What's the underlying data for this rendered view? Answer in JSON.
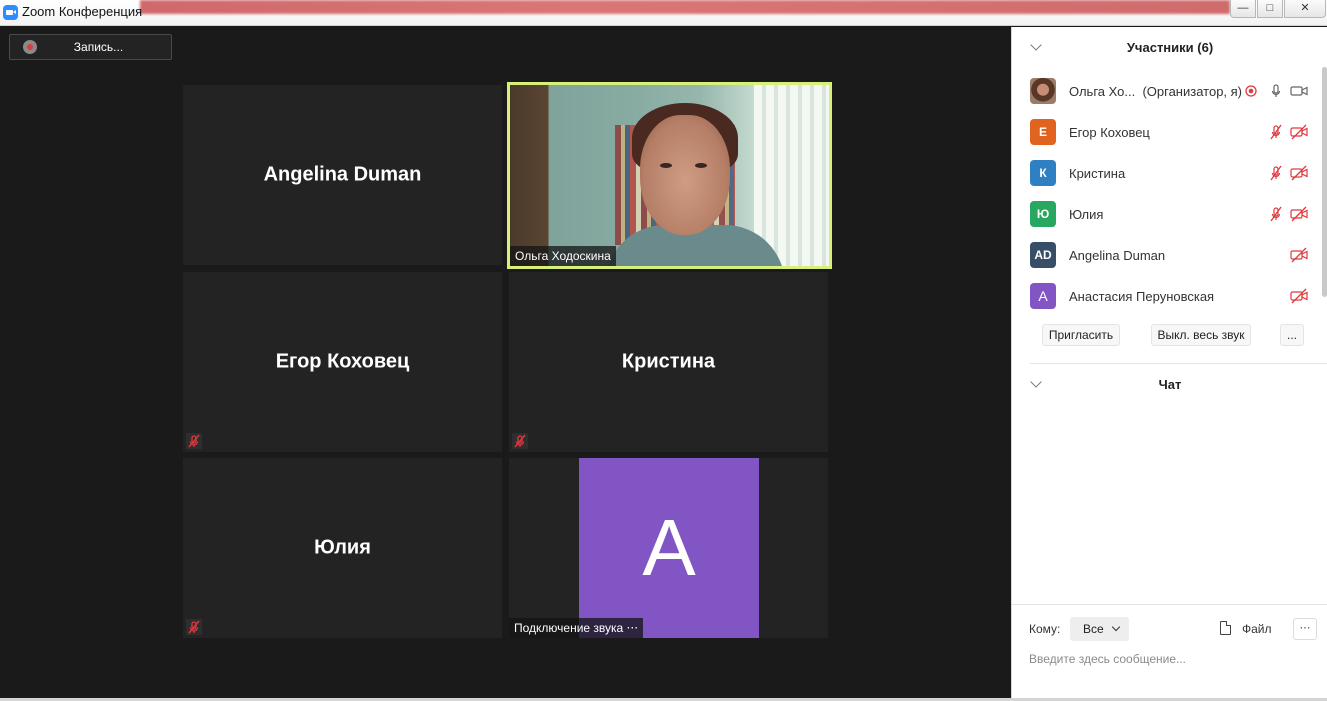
{
  "window": {
    "title": "Zoom Конференция"
  },
  "recording": {
    "label": "Запись..."
  },
  "tiles": [
    {
      "name": "Angelina Duman",
      "muted": false
    },
    {
      "name": "Ольга Ходоскина",
      "video": true
    },
    {
      "name": "Егор Коховец",
      "muted": true
    },
    {
      "name": "Кристина",
      "muted": true
    },
    {
      "name": "Юлия",
      "muted": true
    },
    {
      "avatar_letter": "A",
      "status": "Подключение звука ⋅⋅⋅",
      "avatar_color": "#8155c4"
    }
  ],
  "participants": {
    "header": "Участники (6)",
    "list": [
      {
        "name": "Ольга Хо...",
        "role": "(Организатор, я)",
        "avatar": "photo",
        "mic": "on",
        "video": "on",
        "recording": true
      },
      {
        "name": "Егор Коховец",
        "initials": "Е",
        "color": "#e0631f",
        "mic": "muted",
        "video": "off"
      },
      {
        "name": "Кристина",
        "initials": "К",
        "color": "#2f80c2",
        "mic": "muted",
        "video": "off"
      },
      {
        "name": "Юлия",
        "initials": "Ю",
        "color": "#27a760",
        "mic": "muted",
        "video": "off"
      },
      {
        "name": "Angelina Duman",
        "initials": "AD",
        "color": "#384e66",
        "video": "off"
      },
      {
        "name": "Анастасия Перуновская",
        "initials": "А",
        "color": "#8155c4",
        "video": "off"
      }
    ],
    "invite_label": "Пригласить",
    "mute_all_label": "Выкл. весь звук",
    "more_label": "..."
  },
  "chat": {
    "header": "Чат",
    "to_label": "Кому:",
    "to_value": "Все",
    "file_label": "Файл",
    "more_label": "⋯",
    "placeholder": "Введите здесь сообщение..."
  },
  "colors": {
    "active_speaker_border": "#d6f07a",
    "muted_red": "#e0393e",
    "zoom_blue": "#2d8cff"
  }
}
